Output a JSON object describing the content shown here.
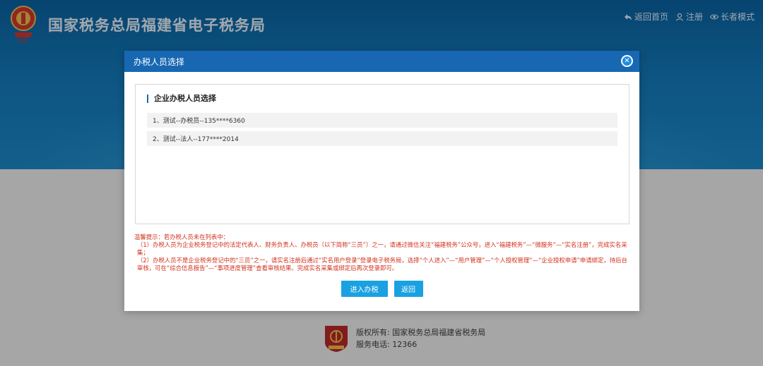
{
  "header": {
    "site_title": "国家税务总局福建省电子税务局",
    "nav": {
      "home": "返回首页",
      "register": "注册",
      "elder_mode": "长者模式"
    }
  },
  "dialog": {
    "title": "办税人员选择",
    "section_title": "企业办税人员选择",
    "persons": [
      "1、测试--办税员--135****6360",
      "2、测试--法人--177****2014"
    ],
    "tip_lines": [
      "温馨提示：若办税人员未在列表中：",
      "（1）办税人员为企业税务登记中的法定代表人、财务负责人、办税员（以下简称“三员”）之一，请通过微信关注“福建税务”公众号，进入“福建税务”—“微服务”—“实名注册”，完成实名采集；",
      "（2）办税人员不是企业税务登记中的“三员”之一，请实名注册后通过“实名用户登录”登录电子税务局，选择“个人进入”—“用户管理”—“个人授权管理”—“企业授权申请”申请绑定，待后台审核，可在“综合信息报告”—“事项进度管理”查看审核结果。完成实名采集或绑定后再次登录即可。"
    ],
    "enter_button": "进入办税",
    "back_button": "返回"
  },
  "footer": {
    "copyright": "版权所有: 国家税务总局福建省税务局",
    "service_phone": "服务电话: 12366"
  },
  "colors": {
    "header_bg": "#1767b3",
    "button_bg": "#1aa1e2",
    "tip_text": "#d0301c"
  }
}
